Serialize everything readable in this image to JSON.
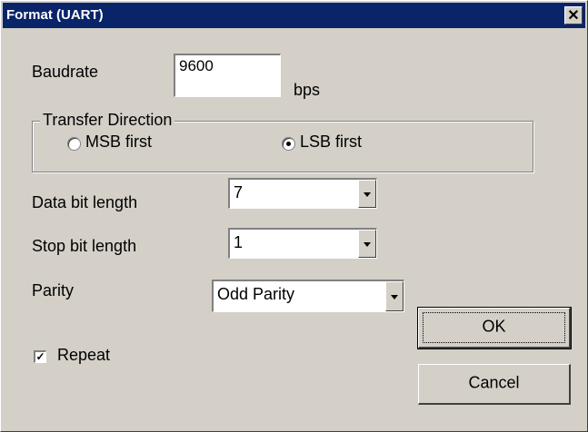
{
  "window": {
    "title": "Format (UART)",
    "close_glyph": "✕"
  },
  "baudrate": {
    "label": "Baudrate",
    "value": "9600",
    "unit": "bps"
  },
  "transfer_direction": {
    "title": "Transfer Direction",
    "options": [
      {
        "label": "MSB first",
        "selected": false
      },
      {
        "label": "LSB first",
        "selected": true
      }
    ]
  },
  "data_bit_length": {
    "label": "Data bit length",
    "value": "7"
  },
  "stop_bit_length": {
    "label": "Stop bit length",
    "value": "1"
  },
  "parity": {
    "label": "Parity",
    "value": "Odd Parity"
  },
  "repeat": {
    "label": "Repeat",
    "checked": true,
    "check_glyph": "✓"
  },
  "buttons": {
    "ok": "OK",
    "cancel": "Cancel"
  },
  "colors": {
    "titlebar": "#0a246a",
    "face": "#d4d0c8"
  }
}
